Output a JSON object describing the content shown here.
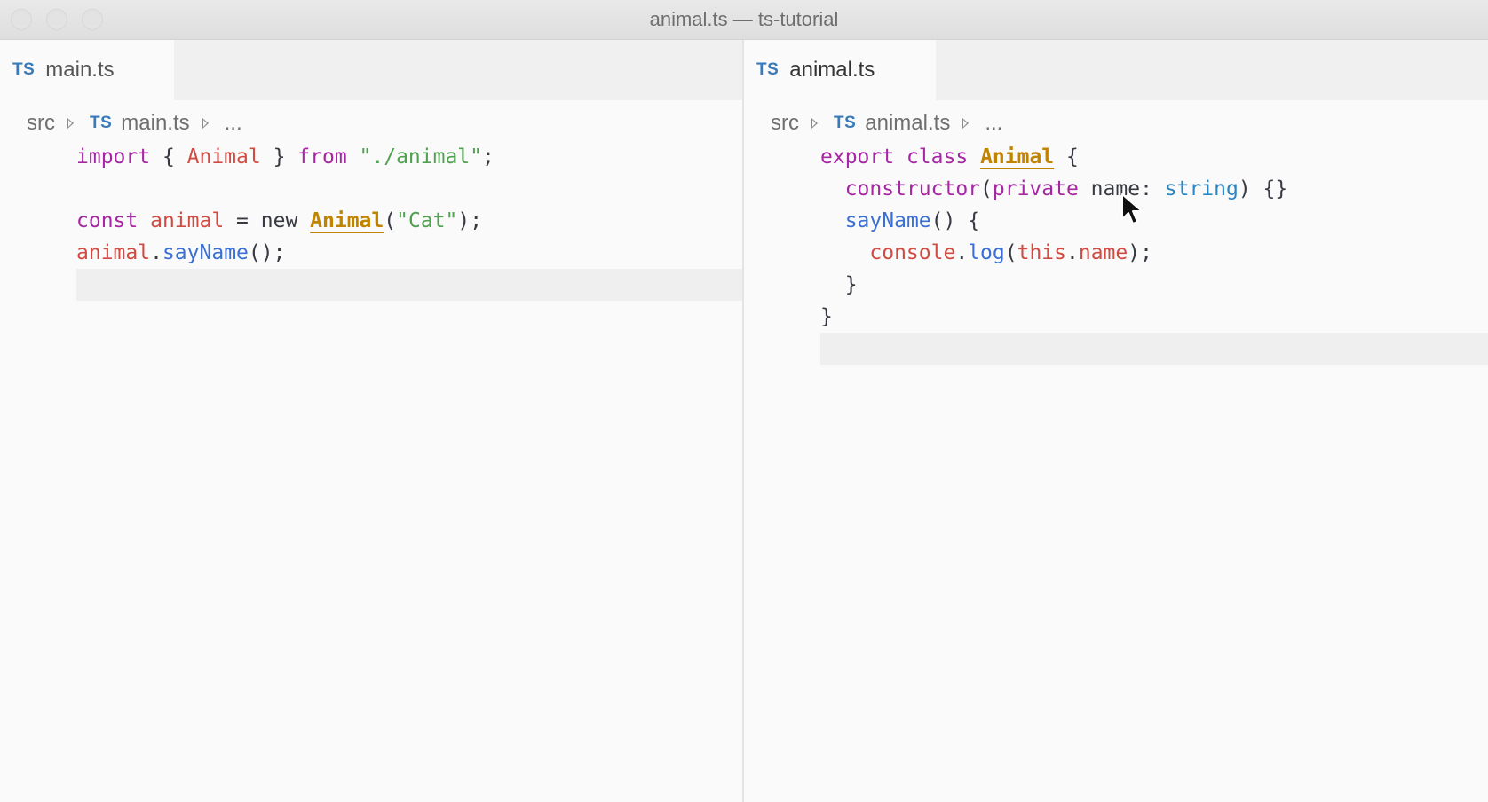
{
  "window": {
    "title": "animal.ts — ts-tutorial"
  },
  "colors": {
    "keyword": "#a626a4",
    "variable": "#d14b43",
    "string": "#50a14f",
    "function": "#3b6fd4",
    "type": "#2a86c2",
    "class": "#c18401",
    "ts_icon": "#3a7ab8"
  },
  "left_editor": {
    "tab": {
      "icon": "TS",
      "label": "main.ts"
    },
    "breadcrumb": {
      "folder": "src",
      "icon": "TS",
      "file": "main.ts",
      "more": "..."
    },
    "code": {
      "line1": {
        "t1": "import",
        "t2": " { ",
        "t3": "Animal",
        "t4": " } ",
        "t5": "from",
        "t6": " ",
        "t7": "\"./animal\"",
        "t8": ";"
      },
      "line3": {
        "t1": "const",
        "t2": " ",
        "t3": "animal",
        "t4": " = ",
        "t5": "new",
        "t6": " ",
        "t7": "Animal",
        "t8": "(",
        "t9": "\"Cat\"",
        "t10": ");"
      },
      "line4": {
        "t1": "animal",
        "t2": ".",
        "t3": "sayName",
        "t4": "();"
      }
    }
  },
  "right_editor": {
    "tab": {
      "icon": "TS",
      "label": "animal.ts"
    },
    "breadcrumb": {
      "folder": "src",
      "icon": "TS",
      "file": "animal.ts",
      "more": "..."
    },
    "code": {
      "line1": {
        "t1": "export",
        "t2": " ",
        "t3": "class",
        "t4": " ",
        "t5": "Animal",
        "t6": " {"
      },
      "line2": {
        "t1": "  ",
        "t2": "constructor",
        "t3": "(",
        "t4": "private",
        "t5": " name: ",
        "t6": "string",
        "t7": ") {}"
      },
      "line3": {
        "t1": "  ",
        "t2": "sayName",
        "t3": "() {"
      },
      "line4": {
        "t1": "    ",
        "t2": "console",
        "t3": ".",
        "t4": "log",
        "t5": "(",
        "t6": "this",
        "t7": ".",
        "t8": "name",
        "t9": ");"
      },
      "line5": {
        "t1": "  }"
      },
      "line6": {
        "t1": "}"
      }
    }
  },
  "pointer": {
    "icon": "mouse-pointer-icon"
  }
}
